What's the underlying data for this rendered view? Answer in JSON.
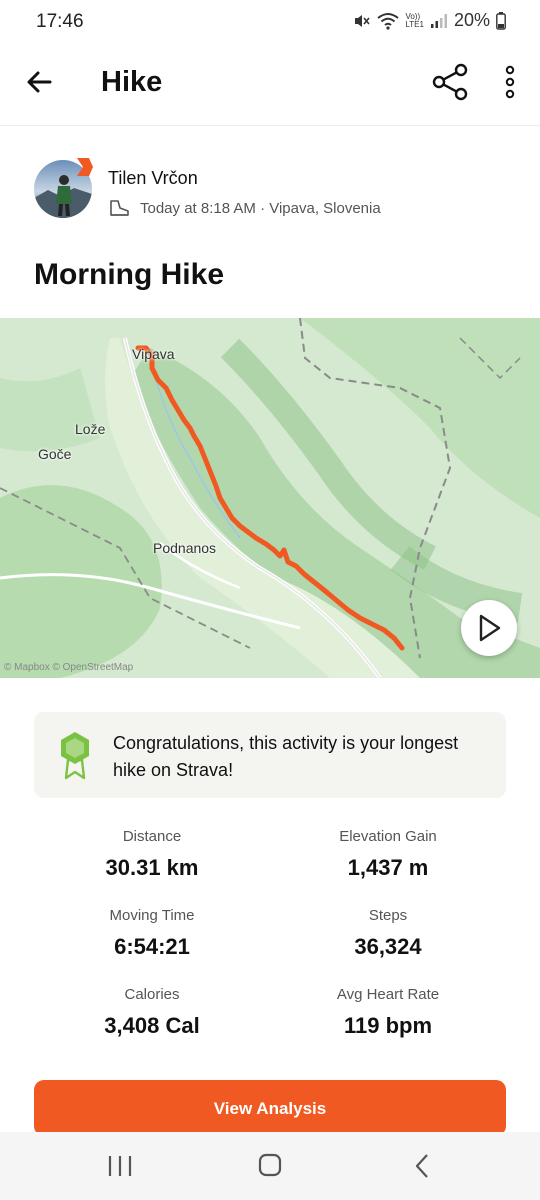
{
  "status": {
    "time": "17:46",
    "battery": "20%",
    "net_label_top": "Vo))",
    "net_label_bottom": "LTE1"
  },
  "header": {
    "title": "Hike",
    "back_icon": "back-arrow-icon",
    "share_icon": "share-icon",
    "more_icon": "more-vertical-icon"
  },
  "athlete": {
    "name": "Tilen Vrčon",
    "meta": "Today at 8:18 AM · Vipava, Slovenia",
    "activity_icon": "hiking-boot-icon"
  },
  "activity": {
    "title": "Morning Hike"
  },
  "map": {
    "labels": {
      "vipava": "Vipava",
      "loze": "Lože",
      "goce": "Goče",
      "podnanos": "Podnanos"
    },
    "attribution": "© Mapbox © OpenStreetMap",
    "route_color": "#f05a22",
    "play_icon": "play-icon"
  },
  "achievement": {
    "text": "Congratulations, this activity is your longest hike on Strava!",
    "icon": "achievement-badge-icon"
  },
  "stats": [
    {
      "label": "Distance",
      "value": "30.31 km"
    },
    {
      "label": "Elevation Gain",
      "value": "1,437 m"
    },
    {
      "label": "Moving Time",
      "value": "6:54:21"
    },
    {
      "label": "Steps",
      "value": "36,324"
    },
    {
      "label": "Calories",
      "value": "3,408 Cal"
    },
    {
      "label": "Avg Heart Rate",
      "value": "119 bpm"
    }
  ],
  "actions": {
    "view_analysis": "View Analysis"
  },
  "colors": {
    "accent": "#f05a22",
    "achievement_green": "#7cc242"
  }
}
